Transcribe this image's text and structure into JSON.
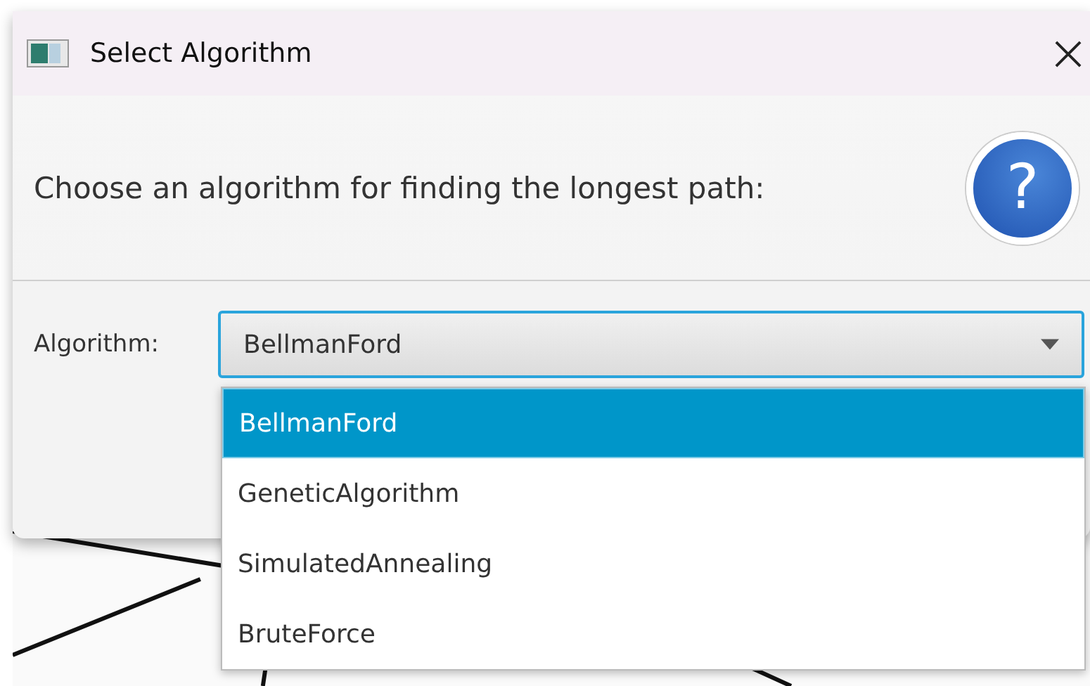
{
  "window": {
    "title": "Select Algorithm"
  },
  "header": {
    "text": "Choose an algorithm for finding the longest path:",
    "icon_glyph": "?"
  },
  "field": {
    "label": "Algorithm:",
    "value": "BellmanFord",
    "expanded": true
  },
  "options": [
    {
      "label": "BellmanFord",
      "selected": true
    },
    {
      "label": "GeneticAlgorithm",
      "selected": false
    },
    {
      "label": "SimulatedAnnealing",
      "selected": false
    },
    {
      "label": "BruteForce",
      "selected": false
    }
  ]
}
